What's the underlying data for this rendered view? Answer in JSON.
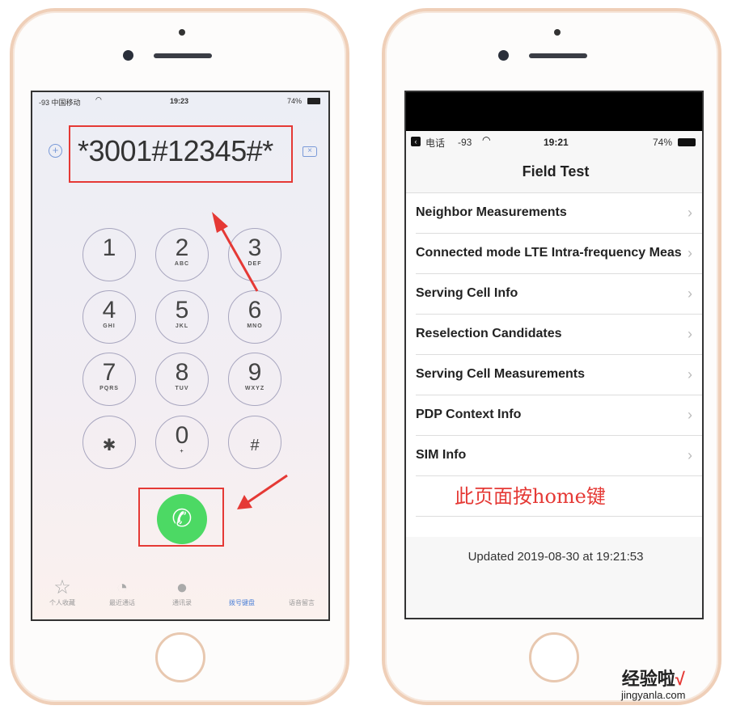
{
  "left": {
    "status": {
      "signal": "-93 中国移动",
      "time": "19:23",
      "battery": "74%"
    },
    "dial_input": "*3001#12345#*",
    "keys": [
      {
        "digit": "1",
        "letters": ""
      },
      {
        "digit": "2",
        "letters": "ABC"
      },
      {
        "digit": "3",
        "letters": "DEF"
      },
      {
        "digit": "4",
        "letters": "GHI"
      },
      {
        "digit": "5",
        "letters": "JKL"
      },
      {
        "digit": "6",
        "letters": "MNO"
      },
      {
        "digit": "7",
        "letters": "PQRS"
      },
      {
        "digit": "8",
        "letters": "TUV"
      },
      {
        "digit": "9",
        "letters": "WXYZ"
      },
      {
        "digit": "✱",
        "letters": ""
      },
      {
        "digit": "0",
        "letters": "+"
      },
      {
        "digit": "#",
        "letters": ""
      }
    ],
    "call_color": "#4cd964",
    "annotation_color": "#e53935",
    "tabs": [
      {
        "label": "个人收藏",
        "icon": "star-icon"
      },
      {
        "label": "最近通话",
        "icon": "clock-icon"
      },
      {
        "label": "通讯录",
        "icon": "contacts-icon"
      },
      {
        "label": "拨号键盘",
        "icon": "keypad-icon",
        "active": true
      },
      {
        "label": "语音留言",
        "icon": "voicemail-icon"
      }
    ]
  },
  "right": {
    "status": {
      "back": "电话",
      "signal": "-93",
      "time": "19:21",
      "battery": "74%"
    },
    "title": "Field Test",
    "items": [
      "Neighbor Measurements",
      "Connected mode LTE Intra-frequency Meas",
      "Serving Cell Info",
      "Reselection Candidates",
      "Serving Cell Measurements",
      "PDP Context Info",
      "SIM Info"
    ],
    "annotation": "此页面按home键",
    "updated": "Updated 2019-08-30 at 19:21:53"
  },
  "watermark": {
    "text": "经验啦",
    "url": "jingyanla.com",
    "check": "√"
  }
}
